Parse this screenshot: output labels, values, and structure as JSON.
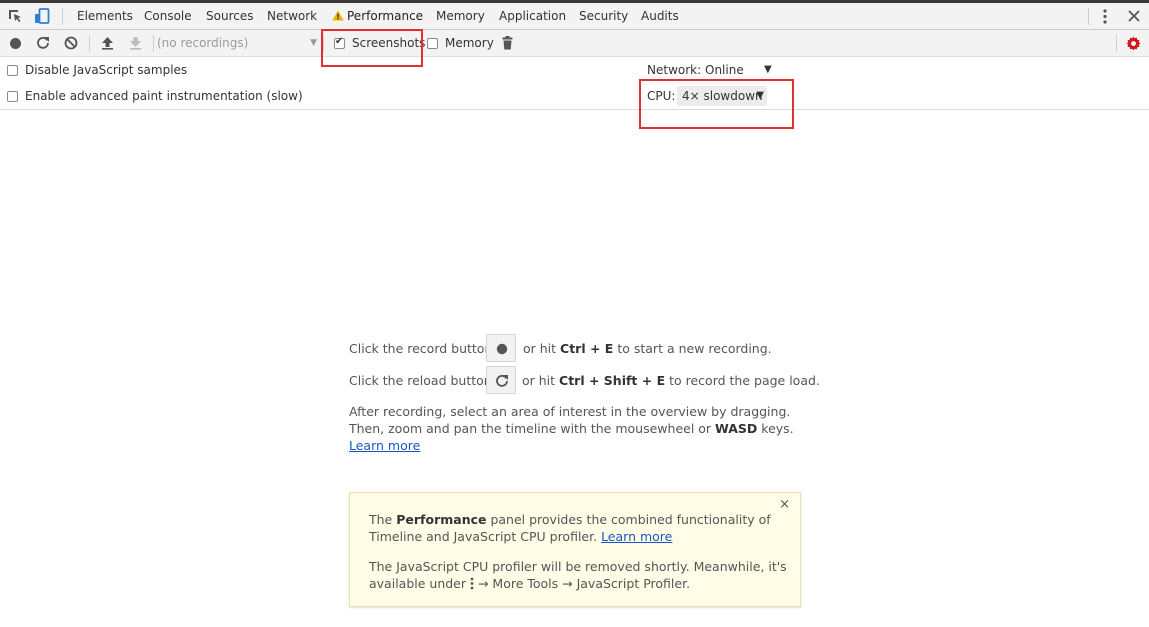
{
  "tabs": [
    "Elements",
    "Console",
    "Sources",
    "Network",
    "Performance",
    "Memory",
    "Application",
    "Security",
    "Audits"
  ],
  "active_tab": "Performance",
  "toolbar": {
    "recordings_placeholder": "(no recordings)",
    "screenshots_label": "Screenshots",
    "screenshots_checked": true,
    "memory_label": "Memory",
    "memory_checked": false
  },
  "settings": {
    "disable_js_samples": "Disable JavaScript samples",
    "advanced_paint": "Enable advanced paint instrumentation (slow)",
    "network_label": "Network:",
    "network_value": "Online",
    "cpu_label": "CPU:",
    "cpu_value": "4× slowdown"
  },
  "landing": {
    "line1_pre": "Click the record button",
    "line1_post_a": "or hit ",
    "line1_keys": "Ctrl + E",
    "line1_post_b": " to start a new recording.",
    "line2_pre": "Click the reload button",
    "line2_post_a": "or hit ",
    "line2_keys": "Ctrl + Shift + E",
    "line2_post_b": " to record the page load.",
    "para1": "After recording, select an area of interest in the overview by dragging.",
    "para2_a": "Then, zoom and pan the timeline with the mousewheel or ",
    "para2_keys": "WASD",
    "para2_b": " keys.",
    "learn_more": "Learn more"
  },
  "notice": {
    "l1_a": "The ",
    "l1_b": "Performance",
    "l1_c": " panel provides the combined functionality of",
    "l2_a": "Timeline and JavaScript CPU profiler. ",
    "l2_link": "Learn more",
    "l3": "The JavaScript CPU profiler will be removed shortly. Meanwhile, it's",
    "l4_a": "available under ",
    "l4_b": " → More Tools → JavaScript Profiler.",
    "close": "×"
  },
  "colors": {
    "highlight_box": "#e03030",
    "warning_icon": "#f0b400",
    "settings_gear": "#d01818",
    "link": "#1a55c2",
    "notice_bg": "#fffde7"
  }
}
